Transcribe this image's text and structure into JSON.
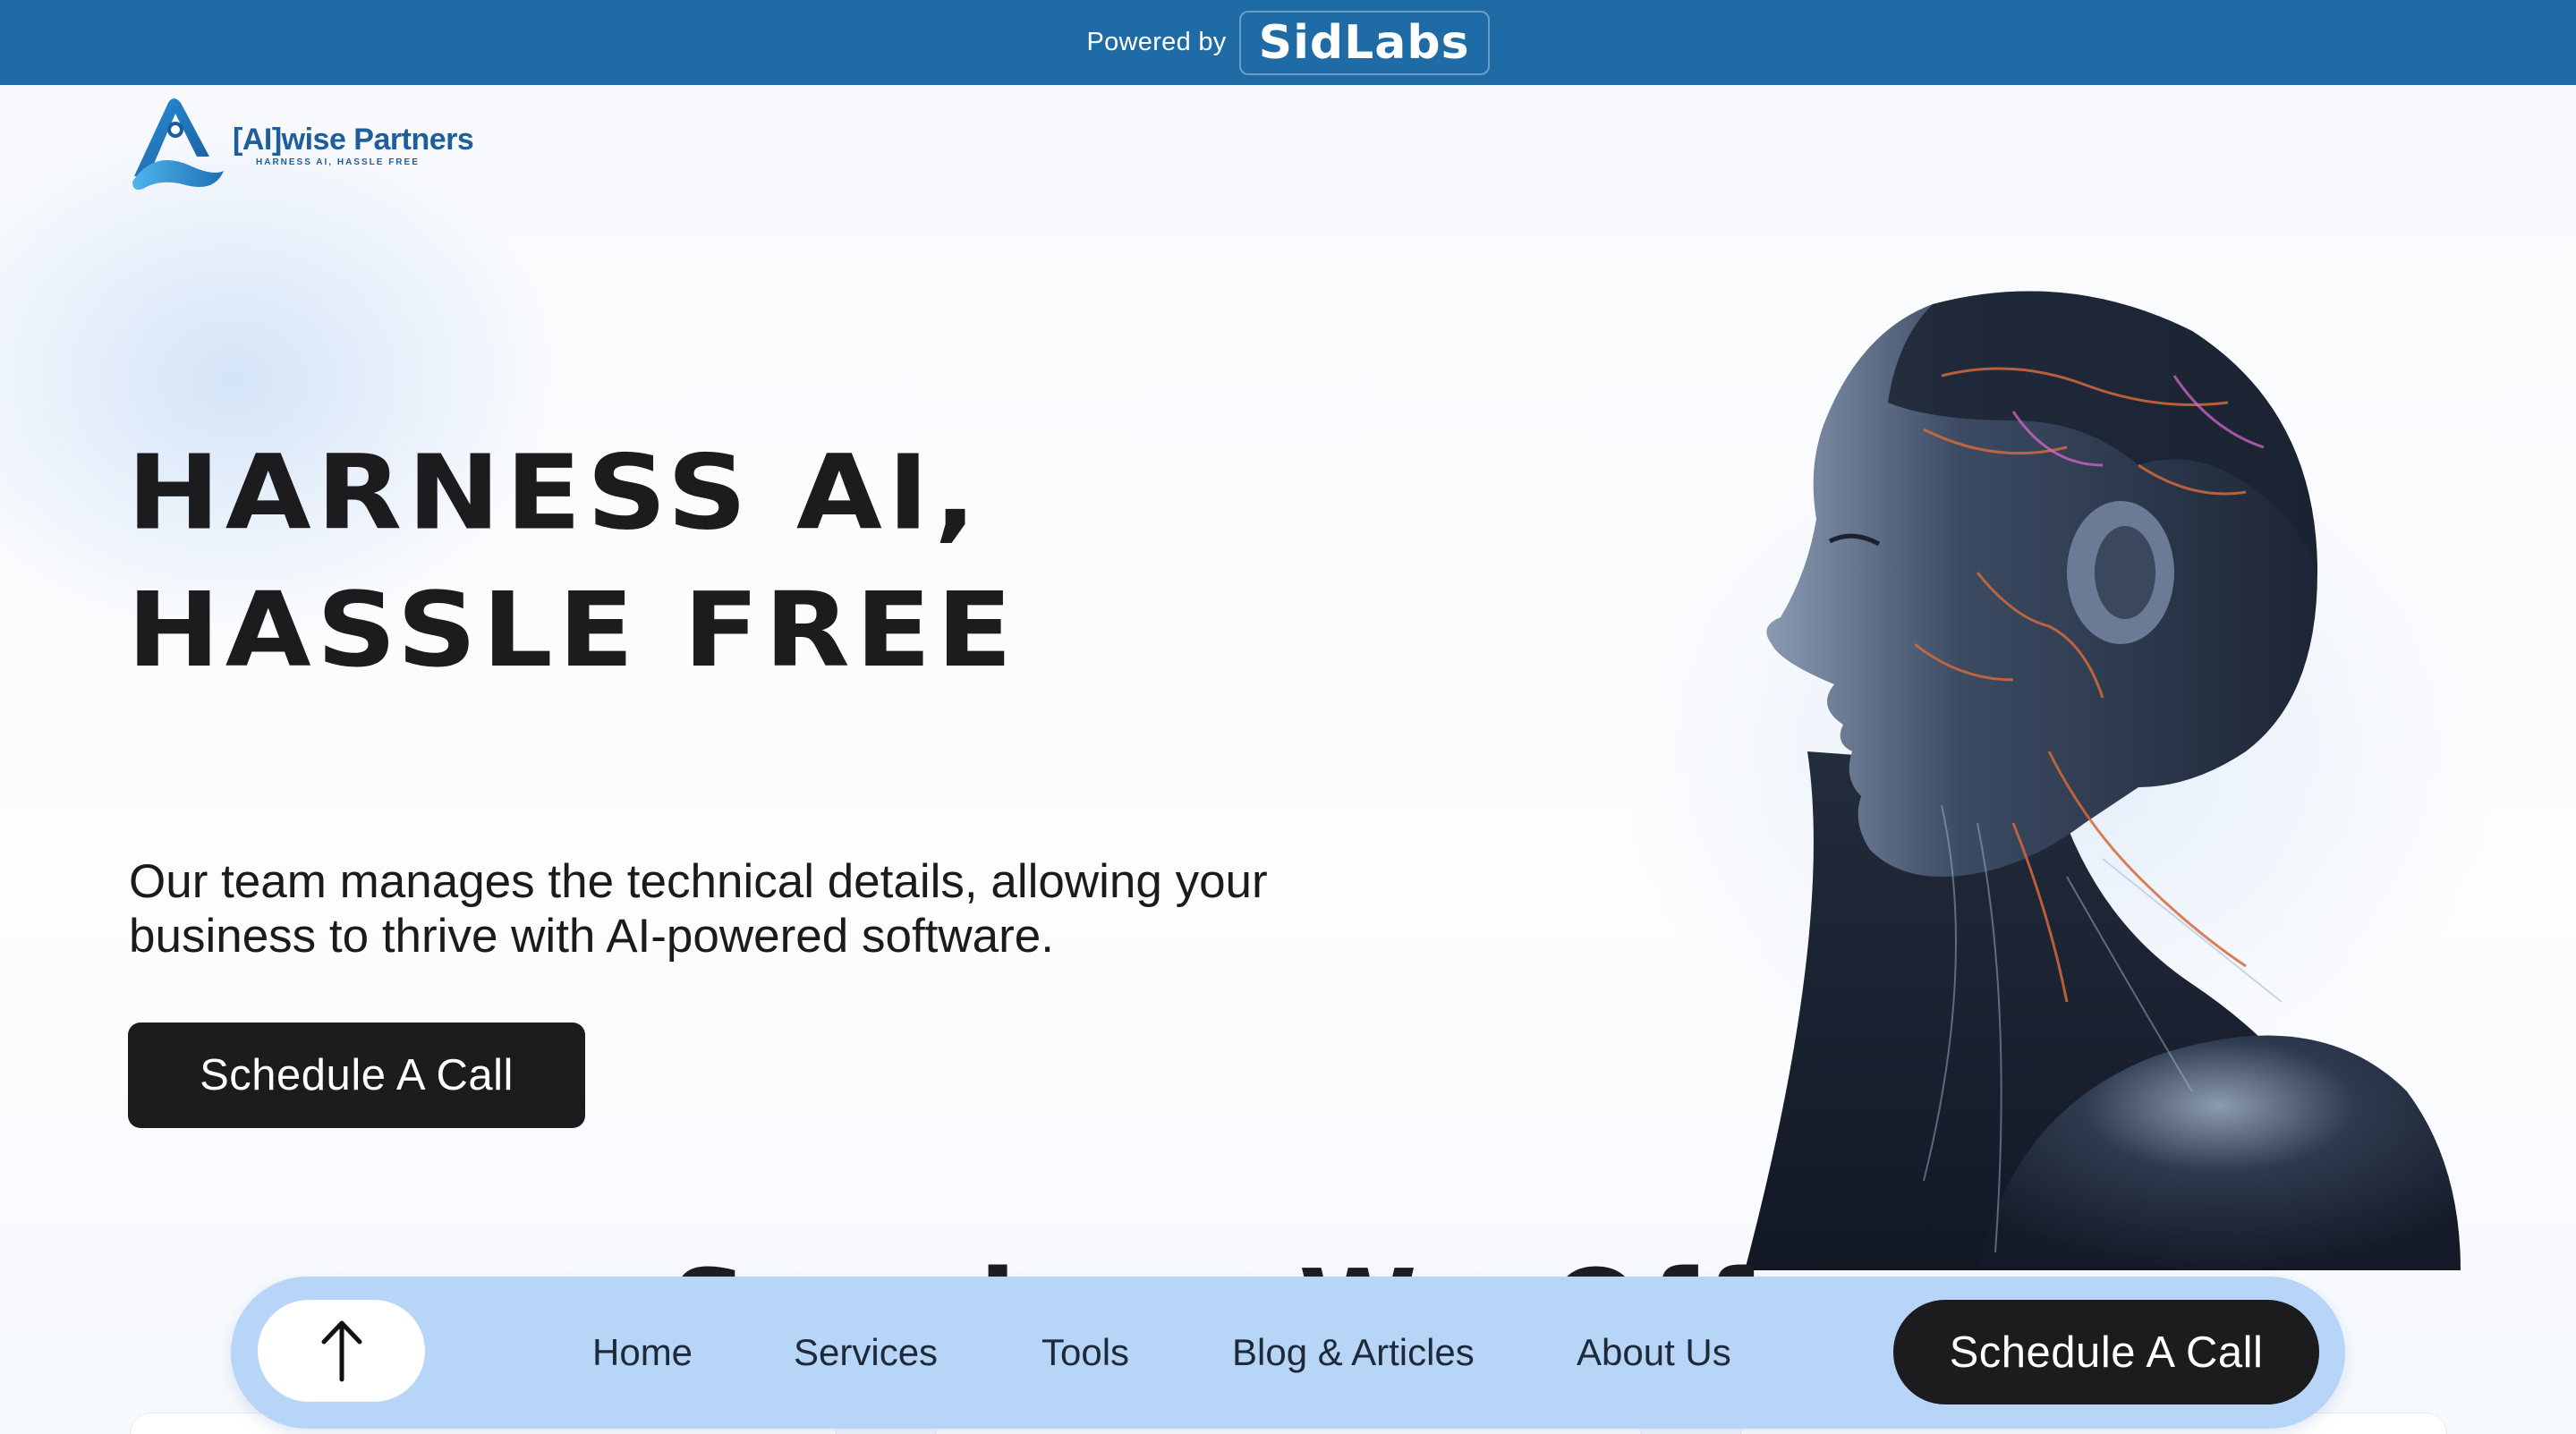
{
  "topbar": {
    "powered_text": "Powered by",
    "brand": "SidLabs"
  },
  "logo": {
    "name": "[AI]wise Partners",
    "tagline": "HARNESS AI, HASSLE FREE"
  },
  "hero": {
    "title_line1": "HARNESS AI,",
    "title_line2": "HASSLE FREE",
    "subtitle": "Our team manages the technical details, allowing your business to thrive with AI-powered software.",
    "cta_label": "Schedule A Call"
  },
  "next_section": {
    "title": "Services We Offer"
  },
  "nav": {
    "items": [
      {
        "label": "Home"
      },
      {
        "label": "Services"
      },
      {
        "label": "Tools"
      },
      {
        "label": "Blog & Articles"
      },
      {
        "label": "About Us"
      }
    ],
    "cta_label": "Schedule A Call",
    "up_icon": "arrow-up-icon"
  },
  "colors": {
    "topbar": "#1e6ba6",
    "brand_blue": "#1f5e9c",
    "nav_bg": "#b6d5f7",
    "dark_button": "#1c1c1e"
  }
}
